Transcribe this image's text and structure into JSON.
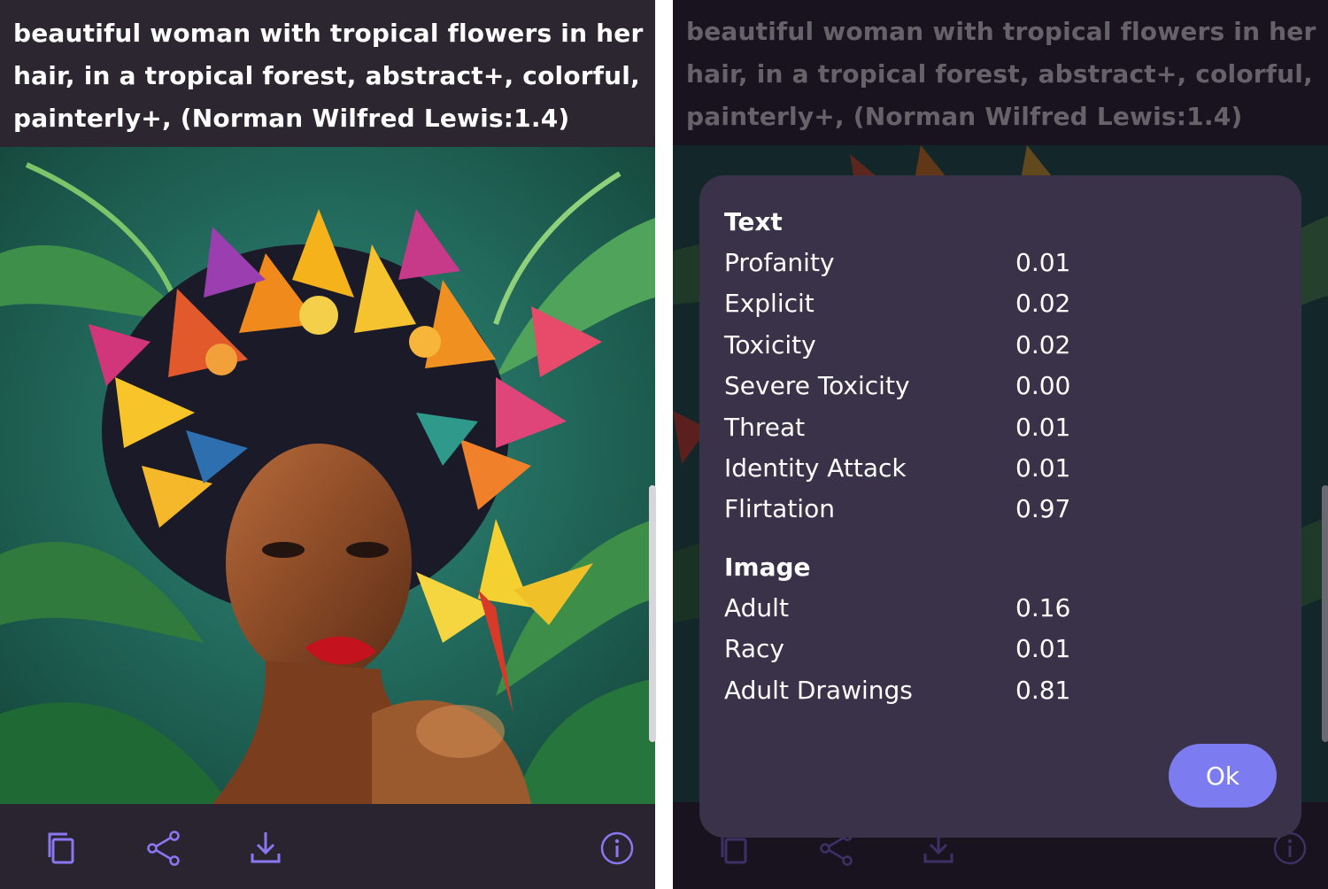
{
  "prompt": {
    "line1": "beautiful woman with tropical flowers in her",
    "line2": "hair, in a tropical forest, abstract+, colorful,",
    "line3": "painterly+, (Norman Wilfred Lewis:1.4)"
  },
  "toolbar": {
    "icons": [
      "copy-icon",
      "share-icon",
      "download-icon",
      "info-icon"
    ],
    "icon_color": "#8a78f0"
  },
  "dialog": {
    "text_section_title": "Text",
    "text_rows": [
      {
        "label": "Profanity",
        "value": "0.01"
      },
      {
        "label": "Explicit",
        "value": "0.02"
      },
      {
        "label": "Toxicity",
        "value": "0.02"
      },
      {
        "label": "Severe Toxicity",
        "value": "0.00"
      },
      {
        "label": "Threat",
        "value": "0.01"
      },
      {
        "label": "Identity Attack",
        "value": "0.01"
      },
      {
        "label": "Flirtation",
        "value": "0.97"
      }
    ],
    "image_section_title": "Image",
    "image_rows": [
      {
        "label": "Adult",
        "value": "0.16"
      },
      {
        "label": "Racy",
        "value": "0.01"
      },
      {
        "label": "Adult Drawings",
        "value": "0.81"
      }
    ],
    "ok_label": "Ok",
    "accent": "#7c7bf0",
    "background": "#393248"
  }
}
